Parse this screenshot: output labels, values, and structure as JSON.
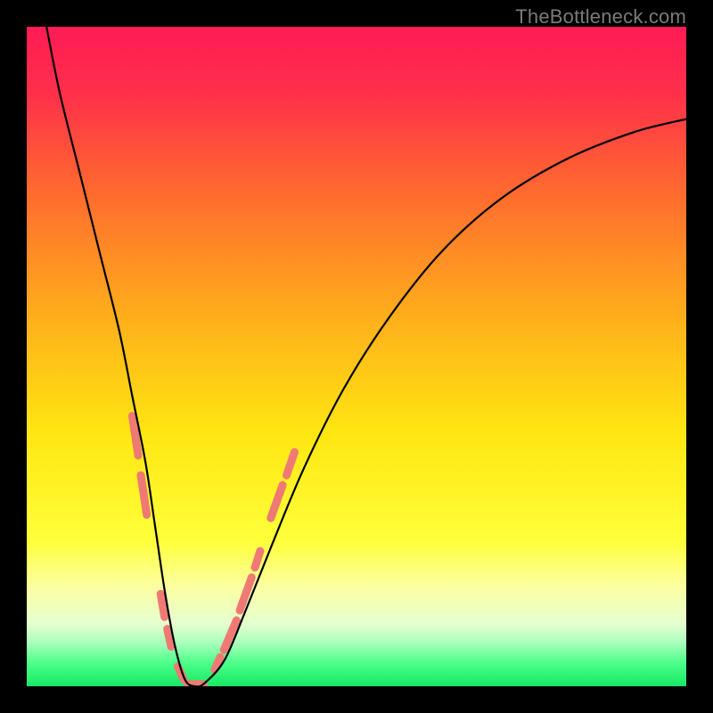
{
  "watermark": "TheBottleneck.com",
  "gradient_stops": [
    {
      "offset": 0.0,
      "color": "#ff1b55"
    },
    {
      "offset": 0.1,
      "color": "#ff2f4a"
    },
    {
      "offset": 0.25,
      "color": "#ff6a2f"
    },
    {
      "offset": 0.45,
      "color": "#ffb21a"
    },
    {
      "offset": 0.62,
      "color": "#ffe712"
    },
    {
      "offset": 0.78,
      "color": "#ffff3a"
    },
    {
      "offset": 0.85,
      "color": "#fbffa2"
    },
    {
      "offset": 0.905,
      "color": "#e6ffd0"
    },
    {
      "offset": 0.935,
      "color": "#a7ffba"
    },
    {
      "offset": 0.965,
      "color": "#4bff88"
    },
    {
      "offset": 1.0,
      "color": "#18e865"
    }
  ],
  "chart_data": {
    "type": "line",
    "title": "",
    "xlabel": "",
    "ylabel": "",
    "xlim": [
      0,
      100
    ],
    "ylim": [
      0,
      100
    ],
    "series": [
      {
        "name": "bottleneck-curve",
        "x": [
          3,
          5,
          8,
          11,
          14,
          16,
          18,
          19.5,
          21,
          22.5,
          24,
          25.5,
          27,
          30,
          33,
          37,
          42,
          48,
          55,
          63,
          72,
          82,
          92,
          100
        ],
        "y": [
          100,
          90,
          78,
          66,
          54,
          44,
          34,
          24,
          14,
          6,
          1,
          0,
          0.5,
          4,
          11,
          21,
          33,
          45,
          56,
          66,
          74,
          80,
          84,
          86
        ]
      }
    ],
    "markers": [
      {
        "name": "highlight-dashes",
        "color": "#ef7a74",
        "stroke_width": 9,
        "segments": [
          {
            "x": [
              16.0,
              16.9
            ],
            "y": [
              41.0,
              35.0
            ]
          },
          {
            "x": [
              17.3,
              18.2
            ],
            "y": [
              32.0,
              26.0
            ]
          },
          {
            "x": [
              20.3,
              20.9
            ],
            "y": [
              14.0,
              10.5
            ]
          },
          {
            "x": [
              21.3,
              21.9
            ],
            "y": [
              8.7,
              6.0
            ]
          },
          {
            "x": [
              22.9,
              23.8
            ],
            "y": [
              3.0,
              1.0
            ]
          },
          {
            "x": [
              24.4,
              26.8
            ],
            "y": [
              0.3,
              0.3
            ]
          },
          {
            "x": [
              28.5,
              29.3
            ],
            "y": [
              2.5,
              4.4
            ]
          },
          {
            "x": [
              29.9,
              31.8
            ],
            "y": [
              5.5,
              10.0
            ]
          },
          {
            "x": [
              32.3,
              34.1
            ],
            "y": [
              11.5,
              16.5
            ]
          },
          {
            "x": [
              34.6,
              35.4
            ],
            "y": [
              18.0,
              20.5
            ]
          },
          {
            "x": [
              37.0,
              38.8
            ],
            "y": [
              25.5,
              30.5
            ]
          },
          {
            "x": [
              39.4,
              40.6
            ],
            "y": [
              32.0,
              35.5
            ]
          }
        ]
      }
    ]
  }
}
